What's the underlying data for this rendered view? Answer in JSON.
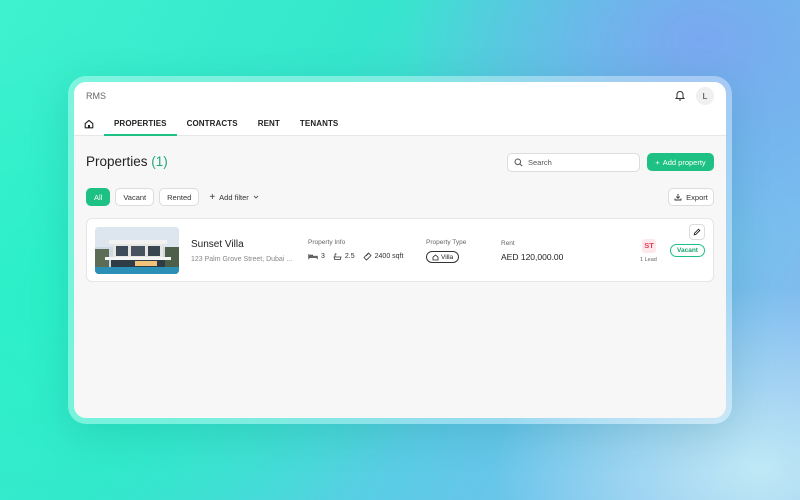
{
  "app": {
    "logo": "RMS",
    "avatar": "L"
  },
  "nav": {
    "tabs": [
      "PROPERTIES",
      "CONTRACTS",
      "RENT",
      "TENANTS"
    ],
    "active_tab": "PROPERTIES"
  },
  "page": {
    "title": "Properties",
    "count": "(1)"
  },
  "search": {
    "placeholder": "Search",
    "value": ""
  },
  "add_property_label": "Add property",
  "filters": {
    "chips": [
      "All",
      "Vacant",
      "Rented"
    ],
    "active": "All",
    "add_filter_label": "Add filter"
  },
  "export_label": "Export",
  "property": {
    "name": "Sunset Villa",
    "address": "123 Palm Grove Street, Dubai ...",
    "info_label": "Property Info",
    "beds": "3",
    "baths": "2.5",
    "area": "2400 sqft",
    "type_label": "Property Type",
    "type": "Villa",
    "rent_label": "Rent",
    "rent": "AED 120,000.00",
    "lead_initials": "ST",
    "lead_count": "1 Lead",
    "status": "Vacant"
  },
  "colors": {
    "accent": "#1dc183",
    "accent_text": "#1aab75",
    "lead_badge": "#e0405e"
  },
  "icons": [
    "home-icon",
    "bell-icon",
    "search-icon",
    "plus-icon",
    "chevron-down-icon",
    "export-icon",
    "bed-icon",
    "bath-icon",
    "area-icon",
    "house-icon",
    "pencil-icon"
  ]
}
